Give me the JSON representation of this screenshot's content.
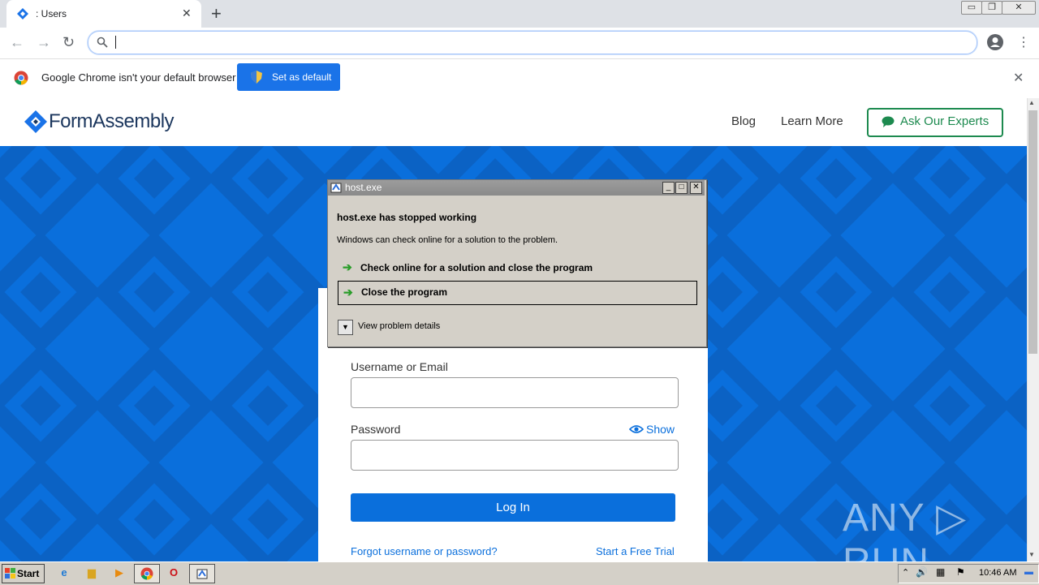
{
  "browser": {
    "tab_title": ": Users",
    "tab_close": "✕",
    "new_tab": "+",
    "window_controls": [
      "▭",
      "❐",
      "✕"
    ],
    "back_icon": "←",
    "forward_icon": "→",
    "reload_icon": "↻",
    "omnibox_value": "",
    "menu_icon": "⋮"
  },
  "infobar": {
    "message": "Google Chrome isn't your default browser",
    "set_default_label": "Set as default",
    "close": "✕"
  },
  "site": {
    "logo_text": "FormAssembly",
    "nav": [
      "Blog",
      "Learn More"
    ],
    "cta_label": "Ask Our Experts",
    "accent_color": "#0a6fdc",
    "cta_color": "#1d8a4f"
  },
  "login": {
    "username_label": "Username or Email",
    "username_value": "",
    "password_label": "Password",
    "password_value": "",
    "show_label": "Show",
    "login_button": "Log In",
    "forgot_link": "Forgot username or password?",
    "trial_link": "Start a Free Trial"
  },
  "dialog": {
    "title": "host.exe",
    "heading": "host.exe has stopped working",
    "description": "Windows can check online for a solution to the problem.",
    "options": [
      "Check online for a solution and close the program",
      "Close the program"
    ],
    "details_label": "View problem details",
    "title_buttons": [
      "_",
      "□",
      "✕"
    ]
  },
  "watermark": "ANY ▷ RUN",
  "taskbar": {
    "start_label": "Start",
    "clock": "10:46 AM",
    "app_icons": [
      "ie-icon",
      "explorer-icon",
      "media-player-icon",
      "chrome-icon",
      "opera-icon",
      "host-exe-icon"
    ]
  }
}
